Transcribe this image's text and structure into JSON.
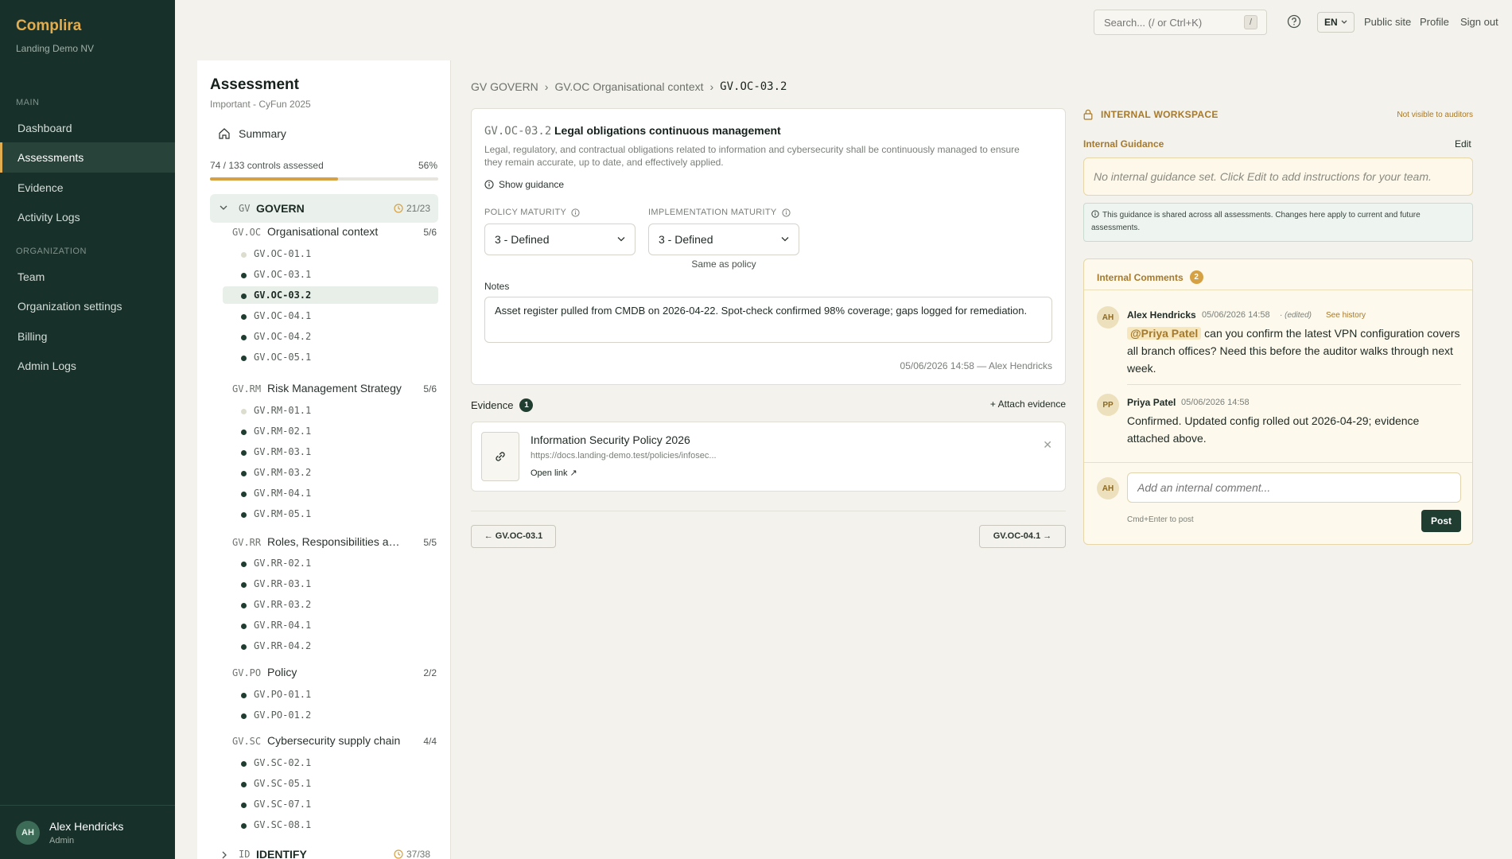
{
  "app": {
    "name": "Complira",
    "org": "Landing Demo NV"
  },
  "sidebar": {
    "section_main": "MAIN",
    "section_org": "ORGANIZATION",
    "items": [
      {
        "label": "Dashboard"
      },
      {
        "label": "Assessments"
      },
      {
        "label": "Evidence"
      },
      {
        "label": "Activity Logs"
      },
      {
        "label": "Team"
      },
      {
        "label": "Organization settings"
      },
      {
        "label": "Billing"
      },
      {
        "label": "Admin Logs"
      }
    ],
    "user": {
      "initials": "AH",
      "name": "Alex Hendricks",
      "role": "Admin"
    }
  },
  "topbar": {
    "search_placeholder": "Search... (/ or Ctrl+K)",
    "search_kbd": "/",
    "lang": "EN",
    "links": [
      "Public site",
      "Profile",
      "Sign out"
    ]
  },
  "assessment": {
    "title": "Assessment",
    "subtitle": "Important - CyFun 2025",
    "summary": "Summary",
    "progress_label": "74 / 133 controls assessed",
    "progress_pct": "56%",
    "progress_fraction": 0.56,
    "group": {
      "code": "GV",
      "name": "GOVERN",
      "count": "21/23"
    },
    "sections": [
      {
        "code": "GV.OC",
        "name": "Organisational context",
        "count": "5/6",
        "controls": [
          {
            "id": "GV.OC-01.1",
            "done": false
          },
          {
            "id": "GV.OC-03.1",
            "done": true
          },
          {
            "id": "GV.OC-03.2",
            "done": true,
            "active": true
          },
          {
            "id": "GV.OC-04.1",
            "done": true
          },
          {
            "id": "GV.OC-04.2",
            "done": true
          },
          {
            "id": "GV.OC-05.1",
            "done": true
          }
        ]
      },
      {
        "code": "GV.RM",
        "name": "Risk Management Strategy",
        "count": "5/6",
        "controls": [
          {
            "id": "GV.RM-01.1",
            "done": false
          },
          {
            "id": "GV.RM-02.1",
            "done": true
          },
          {
            "id": "GV.RM-03.1",
            "done": true
          },
          {
            "id": "GV.RM-03.2",
            "done": true
          },
          {
            "id": "GV.RM-04.1",
            "done": true
          },
          {
            "id": "GV.RM-05.1",
            "done": true
          }
        ]
      },
      {
        "code": "GV.RR",
        "name": "Roles, Responsibilities and Authorities",
        "count": "5/5",
        "controls": [
          {
            "id": "GV.RR-02.1",
            "done": true
          },
          {
            "id": "GV.RR-03.1",
            "done": true
          },
          {
            "id": "GV.RR-03.2",
            "done": true
          },
          {
            "id": "GV.RR-04.1",
            "done": true
          },
          {
            "id": "GV.RR-04.2",
            "done": true
          }
        ]
      },
      {
        "code": "GV.PO",
        "name": "Policy",
        "count": "2/2",
        "controls": [
          {
            "id": "GV.PO-01.1",
            "done": true
          },
          {
            "id": "GV.PO-01.2",
            "done": true
          }
        ]
      },
      {
        "code": "GV.SC",
        "name": "Cybersecurity supply chain",
        "count": "4/4",
        "controls": [
          {
            "id": "GV.SC-02.1",
            "done": true
          },
          {
            "id": "GV.SC-05.1",
            "done": true
          },
          {
            "id": "GV.SC-07.1",
            "done": true
          },
          {
            "id": "GV.SC-08.1",
            "done": true
          }
        ]
      }
    ],
    "next_group": {
      "code": "ID",
      "name": "IDENTIFY",
      "count": "37/38"
    }
  },
  "breadcrumb": [
    "GV GOVERN",
    "GV.OC Organisational context",
    "GV.OC-03.2"
  ],
  "control": {
    "code": "GV.OC-03.2",
    "title": "Legal obligations continuous management",
    "description": "Legal, regulatory, and contractual obligations related to information and cybersecurity shall be continuously managed to ensure they remain accurate, up to date, and effectively applied.",
    "show_guidance": "Show guidance",
    "policy_label": "POLICY MATURITY",
    "policy_value": "3 - Defined",
    "impl_label": "IMPLEMENTATION MATURITY",
    "impl_value": "3 - Defined",
    "same_as_policy": "Same as policy",
    "notes_label": "Notes",
    "notes": "Asset register pulled from CMDB on 2026-04-22. Spot-check confirmed 98% coverage; gaps logged for remediation.",
    "notes_meta": "05/06/2026 14:58 — Alex Hendricks"
  },
  "evidence": {
    "label": "Evidence",
    "count": "1",
    "attach": "+ Attach evidence",
    "item": {
      "title": "Information Security Policy 2026",
      "url": "https://docs.landing-demo.test/policies/infosec...",
      "open": "Open link ↗"
    }
  },
  "pager": {
    "prev": "← GV.OC-03.1",
    "next": "GV.OC-04.1 →"
  },
  "workspace": {
    "title": "INTERNAL WORKSPACE",
    "note": "Not visible to auditors",
    "guidance_label": "Internal Guidance",
    "edit": "Edit",
    "guidance_placeholder": "No internal guidance set. Click Edit to add instructions for your team.",
    "guidance_info": "This guidance is shared across all assessments. Changes here apply to current and future assessments.",
    "comments_label": "Internal Comments",
    "comments_count": "2",
    "comments": [
      {
        "initials": "AH",
        "author": "Alex Hendricks",
        "time": "05/06/2026 14:58",
        "edited": "· (edited)",
        "history": "See history",
        "mention": "@Priya Patel",
        "text": "can you confirm the latest VPN configuration covers all branch offices? Need this before the auditor walks through next week."
      },
      {
        "initials": "PP",
        "author": "Priya Patel",
        "time": "05/06/2026 14:58",
        "text": "Confirmed. Updated config rolled out 2026-04-29; evidence attached above."
      }
    ],
    "new_initials": "AH",
    "new_placeholder": "Add an internal comment...",
    "new_hint": "Cmd+Enter to post",
    "post": "Post"
  }
}
